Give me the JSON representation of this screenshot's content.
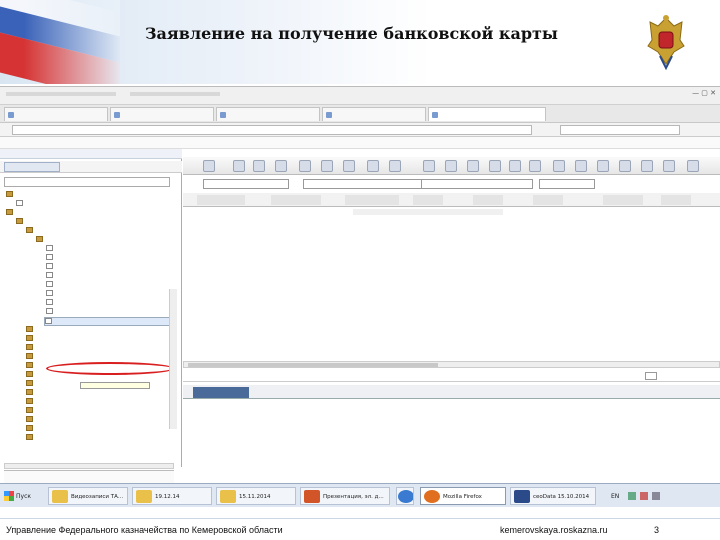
{
  "slide": {
    "title": "Заявление на получение банковской карты",
    "footer_left": "Управление Федерального казначейства по Кемеровской области",
    "footer_center": "kemerovskaya.roskazna.ru",
    "page_number": "3"
  },
  "colors": {
    "flag_white": "#f4f6fb",
    "flag_blue": "#3a62b8",
    "flag_red": "#d63434",
    "callout": "#d81e1e",
    "active_tab": "#4a6a9a"
  },
  "taskbar": {
    "start_label": "Пуск",
    "items": [
      {
        "label": "Видеозаписи ТА...",
        "icon": "folder-icon"
      },
      {
        "label": "19.12.14",
        "icon": "folder-icon"
      },
      {
        "label": "15.11.2014",
        "icon": "folder-icon"
      },
      {
        "label": "Презентация, эл. д...",
        "icon": "powerpoint-icon"
      },
      {
        "label": "Mozilla Firefox",
        "icon": "firefox-icon"
      },
      {
        "label": "ceoData 15.10.2014",
        "icon": "app-icon"
      }
    ],
    "lang": "EN"
  }
}
